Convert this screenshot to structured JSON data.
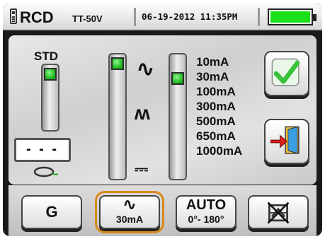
{
  "header": {
    "title": "RCD",
    "system": "TT-50V",
    "datetime": "06-19-2012 11:35PM",
    "battery_level": 1.0
  },
  "left_slider": {
    "label": "STD",
    "value": "- - -"
  },
  "waveform_slider": {
    "symbols": [
      "∿",
      "ʍ",
      "⎓"
    ]
  },
  "current_list": {
    "items": [
      "10mA",
      "30mA",
      "100mA",
      "300mA",
      "500mA",
      "650mA",
      "1000mA"
    ],
    "selected_index": 1
  },
  "side_buttons": {
    "confirm": "check-icon",
    "exit": "exit-door-icon"
  },
  "bottom_bar": {
    "g_label": "G",
    "wave_symbol": "∿",
    "wave_current": "30mA",
    "auto_label": "AUTO",
    "auto_range": "0°- 180°",
    "disabled_icon": "no-delay-icon"
  },
  "colors": {
    "accent_green": "#19e019",
    "selection_orange": "#d98a1a",
    "check_green": "#3ac23a"
  }
}
